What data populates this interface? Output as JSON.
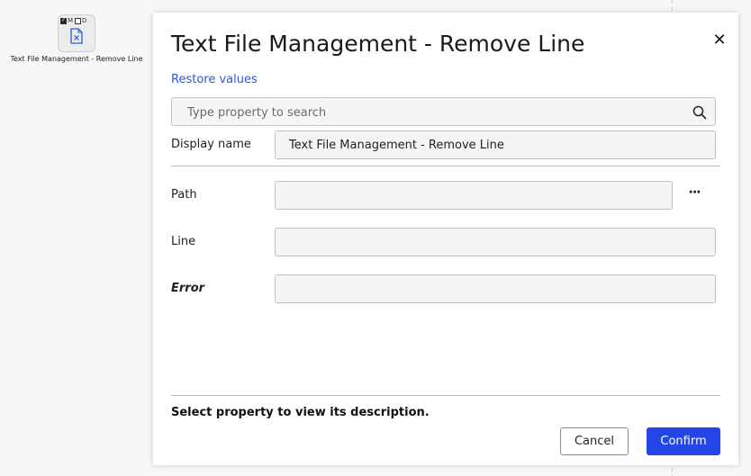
{
  "canvas": {
    "node": {
      "flags": [
        {
          "letter": "",
          "checked": true
        },
        {
          "letter": "M",
          "checked": false
        },
        {
          "letter": "D",
          "checked": false
        }
      ],
      "flag_m": "M",
      "flag_d": "D",
      "icon": "file-x-icon",
      "label": "Text File Management - Remove Line"
    }
  },
  "dialog": {
    "title": "Text File Management - Remove Line",
    "close_icon": "close-icon",
    "restore_label": "Restore values",
    "search": {
      "placeholder": "Type property to search",
      "value": "",
      "icon": "search-icon"
    },
    "display_name": {
      "label": "Display name",
      "value": "Text File Management - Remove Line"
    },
    "properties": [
      {
        "label": "Path",
        "value": "",
        "has_browse": true
      },
      {
        "label": "Line",
        "value": ""
      },
      {
        "label": "Error",
        "value": "",
        "emphasis": "bold-italic"
      }
    ],
    "browse_label": "···",
    "description_text": "Select property to view its description.",
    "buttons": {
      "cancel": "Cancel",
      "confirm": "Confirm"
    }
  },
  "colors": {
    "accent": "#2445e8",
    "link": "#2a57d6",
    "field_bg": "#f5f5f5",
    "field_border": "#c2c2c2"
  }
}
